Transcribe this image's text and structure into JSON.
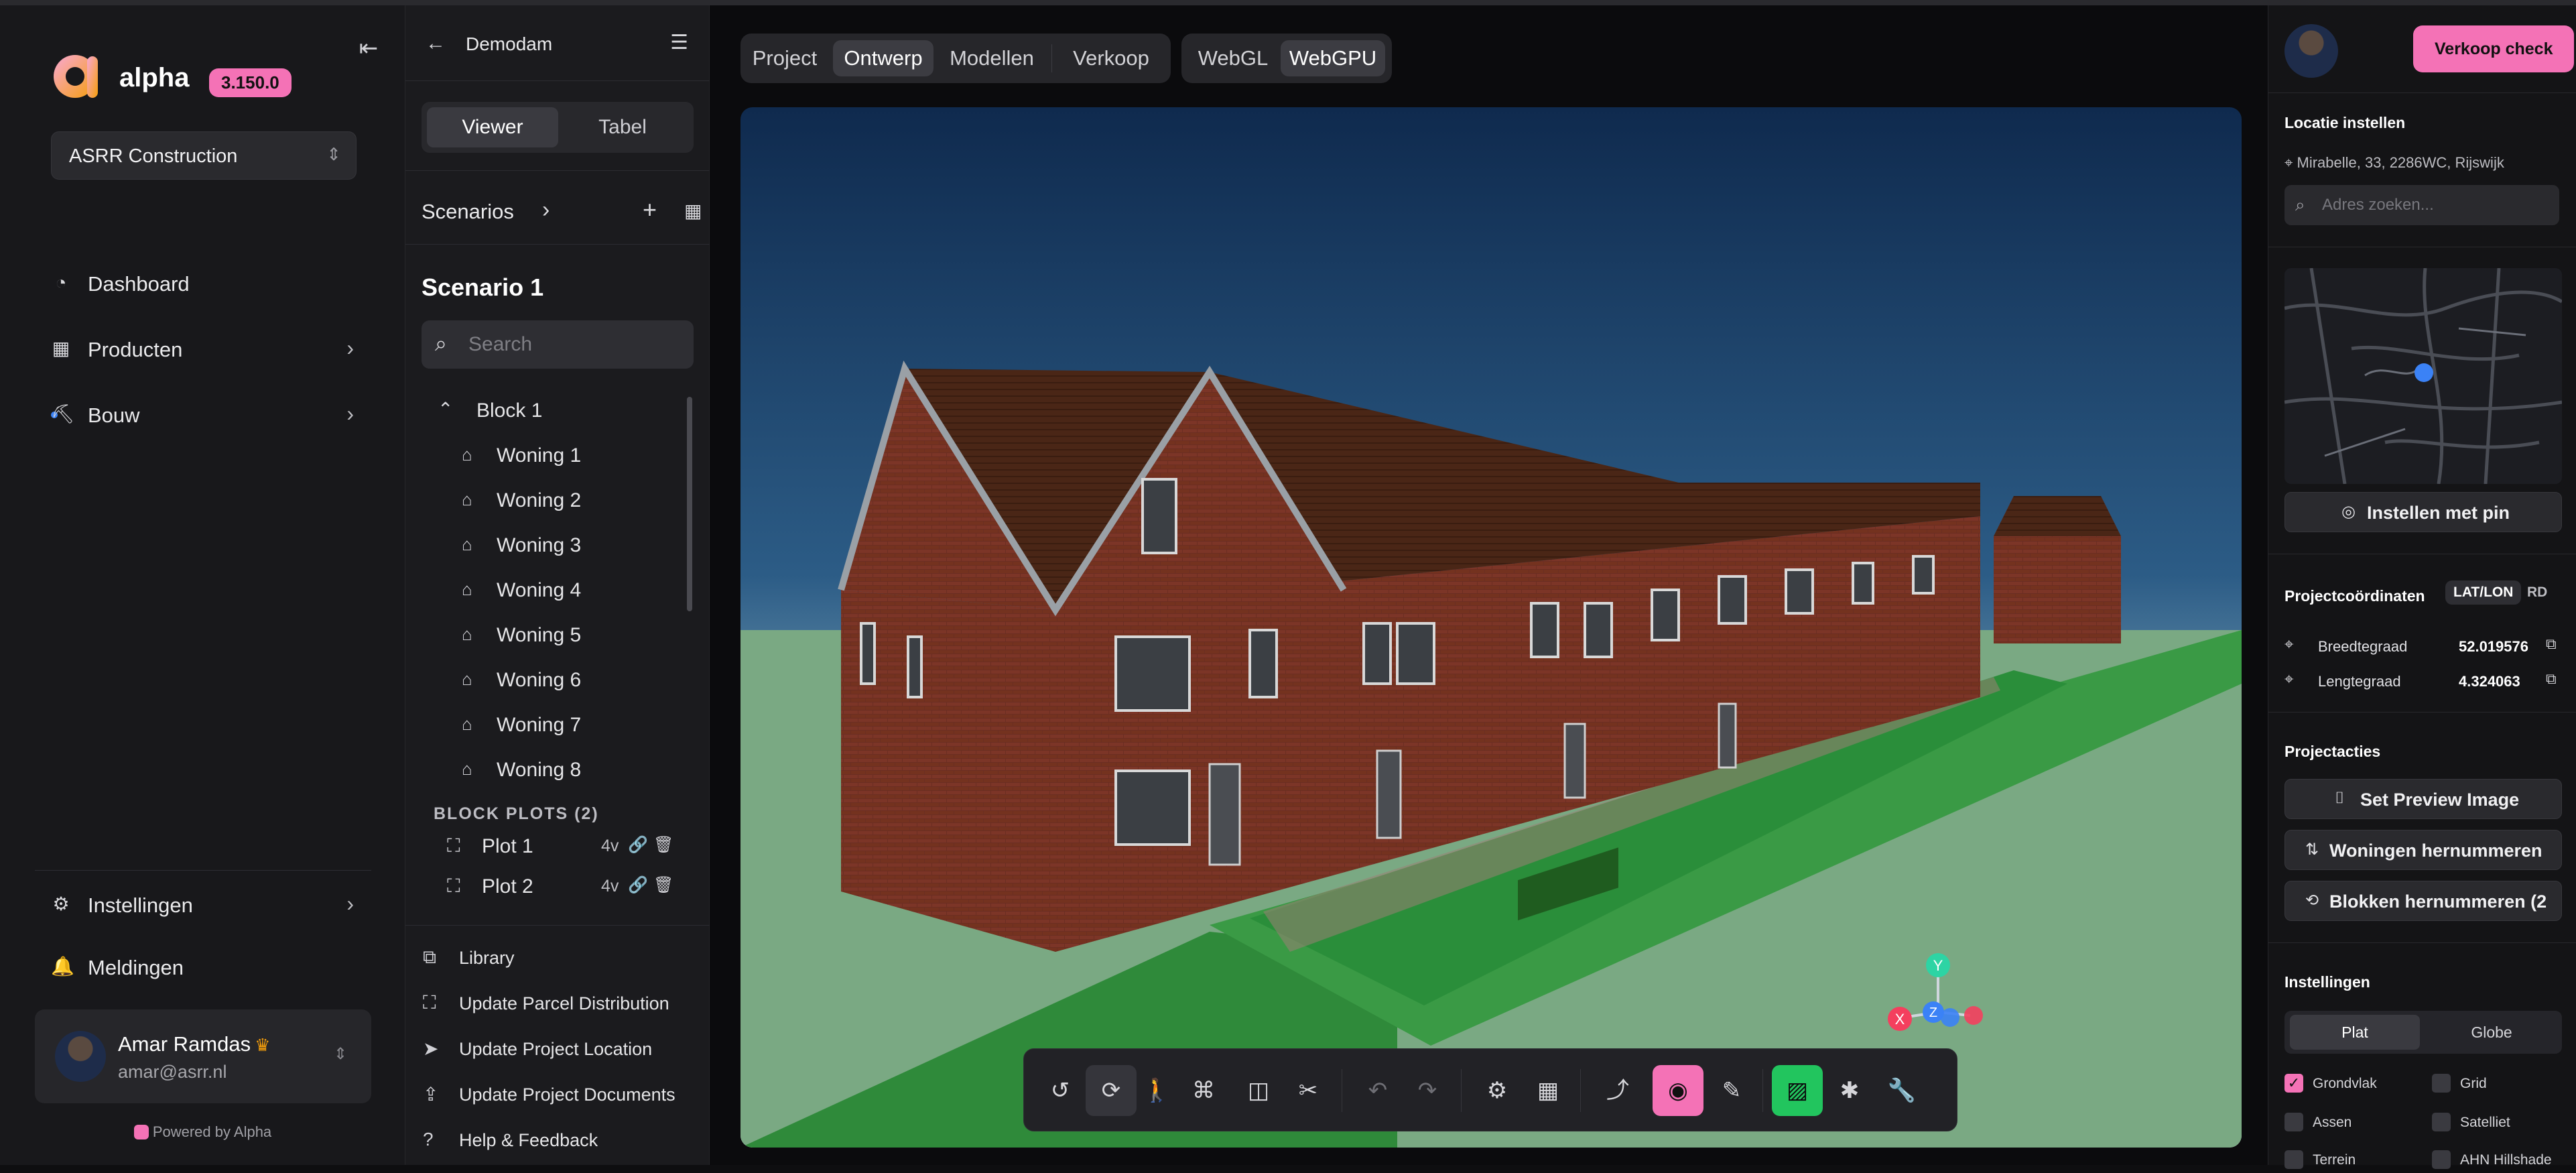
{
  "app": {
    "name": "alpha",
    "version": "3.150.0",
    "org": "ASRR Construction",
    "powered_by": "Powered by Alpha"
  },
  "nav": {
    "items": [
      {
        "label": "Dashboard",
        "icon": "gauge-icon"
      },
      {
        "label": "Producten",
        "icon": "grid-icon"
      },
      {
        "label": "Bouw",
        "icon": "crane-icon"
      }
    ],
    "bottom": [
      {
        "label": "Instellingen",
        "icon": "gear-icon"
      },
      {
        "label": "Meldingen",
        "icon": "bell-icon"
      }
    ],
    "user": {
      "name": "Amar Ramdas",
      "email": "amar@asrr.nl"
    }
  },
  "panel": {
    "title": "Demodam",
    "view_options": [
      "Viewer",
      "Tabel"
    ],
    "active_view": "Viewer",
    "scenarios_label": "Scenarios",
    "scenario_title": "Scenario 1",
    "search_placeholder": "Search",
    "block": "Block 1",
    "woningen": [
      "Woning 1",
      "Woning 2",
      "Woning 3",
      "Woning 4",
      "Woning 5",
      "Woning 6",
      "Woning 7",
      "Woning 8"
    ],
    "plots_label": "BLOCK PLOTS (2)",
    "plots": [
      {
        "label": "Plot 1",
        "value": "4v"
      },
      {
        "label": "Plot 2",
        "value": "4v"
      }
    ],
    "actions": [
      "Library",
      "Update Parcel Distribution",
      "Update Project Location",
      "Update Project Documents",
      "Help & Feedback"
    ]
  },
  "main": {
    "tabs": [
      "Project",
      "Ontwerp",
      "Modellen",
      "Verkoop"
    ],
    "active_tab": "Ontwerp",
    "renderers": [
      "WebGL",
      "WebGPU"
    ],
    "active_renderer": "WebGPU"
  },
  "gizmo": {
    "x": "X",
    "y": "Y",
    "z": "Z"
  },
  "right": {
    "primary_button": "Verkoop check",
    "location_heading": "Locatie instellen",
    "address": "Mirabelle, 33, 2286WC, Rijswijk",
    "address_placeholder": "Adres zoeken...",
    "pin_button": "Instellen met pin",
    "coords_heading": "Projectcoördinaten",
    "coord_modes": [
      "LAT/LON",
      "RD"
    ],
    "active_coord_mode": "LAT/LON",
    "lat_label": "Breedtegraad",
    "lat_value": "52.019576",
    "lon_label": "Lengtegraad",
    "lon_value": "4.324063",
    "actions_heading": "Projectacties",
    "actions": [
      "Set Preview Image",
      "Woningen hernummeren",
      "Blokken hernummeren (2"
    ],
    "settings_heading": "Instellingen",
    "modes": [
      "Plat",
      "Globe"
    ],
    "active_mode": "Plat",
    "checkboxes": [
      {
        "label": "Grondvlak",
        "checked": true
      },
      {
        "label": "Grid",
        "checked": false
      },
      {
        "label": "Assen",
        "checked": false
      },
      {
        "label": "Satelliet",
        "checked": false
      },
      {
        "label": "Terrein",
        "checked": false
      },
      {
        "label": "AHN Hillshade",
        "checked": false
      }
    ]
  },
  "colors": {
    "accent_pink": "#f472b6",
    "accent_green": "#22c55e",
    "accent_blue": "#3b82f6"
  }
}
